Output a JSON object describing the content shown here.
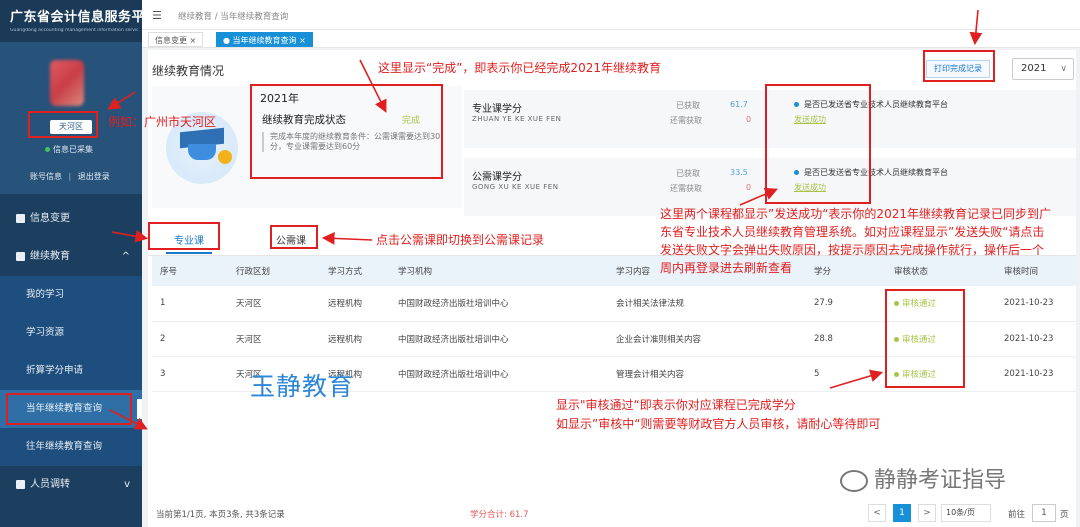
{
  "brand": {
    "title": "广东省会计信息服务平台",
    "subtitle": "Guangdong accounting management information service platform"
  },
  "profile": {
    "district": "天河区",
    "collected": "信息已采集",
    "account_info": "账号信息",
    "logout": "退出登录",
    "separator": "|"
  },
  "sidebar": {
    "items": [
      {
        "label": "信息变更"
      },
      {
        "label": "继续教育",
        "expanded_arrow": "^"
      },
      {
        "label": "人员调转",
        "collapsed_arrow": "v"
      }
    ],
    "sub_items": [
      {
        "label": "我的学习"
      },
      {
        "label": "学习资源"
      },
      {
        "label": "折算学分申请"
      },
      {
        "label": "当年继续教育查询"
      },
      {
        "label": "往年继续教育查询"
      }
    ]
  },
  "breadcrumb": {
    "text": "继续教育 / 当年继续教育查询"
  },
  "tabs": [
    {
      "label": "信息变更 ×"
    },
    {
      "label": "● 当年继续教育查询 ×"
    }
  ],
  "main": {
    "title": "继续教育情况",
    "print_button": "打印完成记录",
    "year_select": "2021",
    "status_card": {
      "year": "2021年",
      "title": "继续教育完成状态",
      "status": "完成",
      "desc": "完成本年度的继续教育条件：公需课需要达到30分，专业课需要达到60分"
    },
    "credits": [
      {
        "name": "专业课学分",
        "pinyin": "ZHUAN YE KE XUE FEN",
        "gained_label": "已获取",
        "gained": "61.7",
        "need_label": "还需获取",
        "need": "0",
        "sync_label": "是否已发送省专业技术人员继续教育平台",
        "sync_status": "发送成功"
      },
      {
        "name": "公需课学分",
        "pinyin": "GONG XU KE XUE FEN",
        "gained_label": "已获取",
        "gained": "33.5",
        "need_label": "还需获取",
        "need": "0",
        "sync_label": "是否已发送省专业技术人员继续教育平台",
        "sync_status": "发送成功"
      }
    ],
    "course_tabs": [
      {
        "label": "专业课"
      },
      {
        "label": "公需课"
      }
    ],
    "table": {
      "headers": [
        "序号",
        "行政区划",
        "学习方式",
        "学习机构",
        "学习内容",
        "学分",
        "审核状态",
        "审核时间"
      ],
      "rows": [
        [
          "1",
          "天河区",
          "远程机构",
          "中国财政经济出版社培训中心",
          "会计相关法律法规",
          "27.9",
          "审核通过",
          "2021-10-23"
        ],
        [
          "2",
          "天河区",
          "远程机构",
          "中国财政经济出版社培训中心",
          "企业会计准则相关内容",
          "28.8",
          "审核通过",
          "2021-10-23"
        ],
        [
          "3",
          "天河区",
          "远程机构",
          "中国财政经济出版社培训中心",
          "管理会计相关内容",
          "5",
          "审核通过",
          "2021-10-23"
        ]
      ]
    },
    "footer": {
      "page_info": "当前第1/1页, 本页3条, 共3条记录",
      "sum": "学分合计: 61.7",
      "prev": "<",
      "current_page": "1",
      "next": ">",
      "page_size": "10条/页",
      "goto_label": "前往",
      "goto_value": "1",
      "page_suffix": "页"
    }
  },
  "annotations": {
    "district_example": "例如：广州市天河区",
    "done_note": "这里显示“完成”，即表示你已经完成2021年继续教育",
    "sync_note": "这里两个课程都显示”发送成功“表示你的2021年继续教育记录已同步到广东省专业技术人员继续教育管理系统。如对应课程显示”发送失败“请点击发送失败文字会弹出失败原因，按提示原因去完成操作就行，操作后一个周内再登录进去刷新查看",
    "switch_note": "点击公需课即切换到公需课记录",
    "audit_note_1": "显示\"审核通过“即表示你对应课程已完成学分",
    "audit_note_2": "如显示”审核中“则需要等财政官方人员审核，请耐心等待即可"
  },
  "watermarks": {
    "center": "玉静教育",
    "wechat": "静静考证指导"
  },
  "colors": {
    "sidebar": "#1c3f60",
    "accent": "#1890d8",
    "success": "#a8c44a",
    "annotation": "#e02020"
  }
}
